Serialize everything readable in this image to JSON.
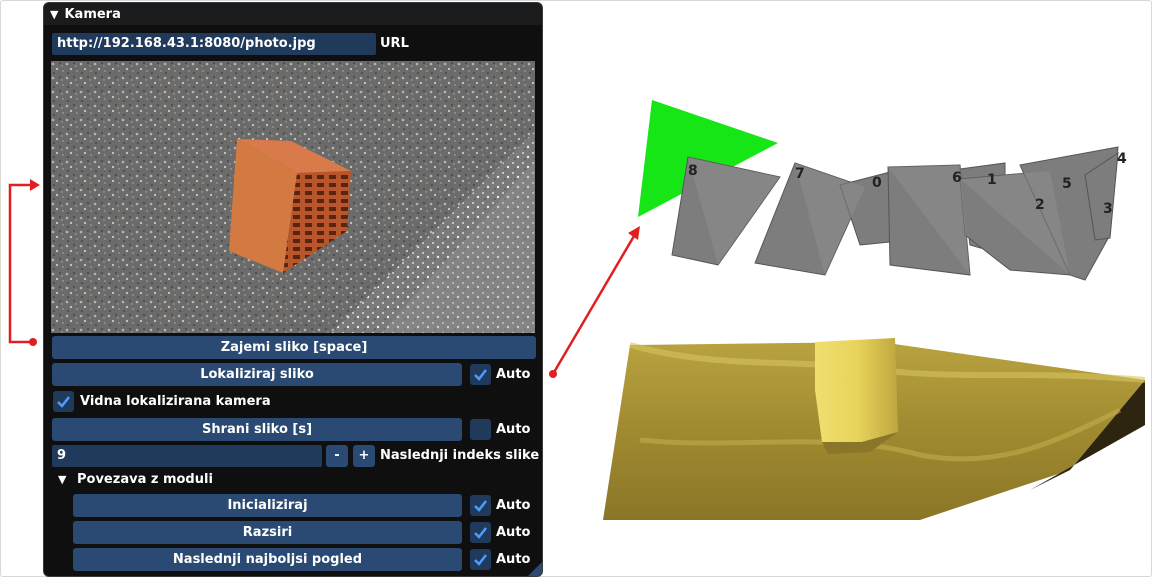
{
  "window": {
    "title": "Kamera"
  },
  "camera": {
    "url_value": "http://192.168.43.1:8080/photo.jpg",
    "url_label": "URL"
  },
  "controls": {
    "capture_button": "Zajemi sliko [space]",
    "localize_button": "Lokaliziraj sliko",
    "localize_auto_label": "Auto",
    "localize_auto_checked": true,
    "visible_localized_label": "Vidna lokalizirana kamera",
    "visible_localized_checked": true,
    "save_button": "Shrani sliko [s]",
    "save_auto_label": "Auto",
    "save_auto_checked": false,
    "index_value": "9",
    "minus_label": "-",
    "plus_label": "+",
    "index_label": "Naslednji indeks slike"
  },
  "modules": {
    "header": "Povezava z moduli",
    "items": [
      {
        "label": "Inicializiraj",
        "auto_label": "Auto",
        "auto_checked": true
      },
      {
        "label": "Razsiri",
        "auto_label": "Auto",
        "auto_checked": true
      },
      {
        "label": "Naslednji najboljsi pogled",
        "auto_label": "Auto",
        "auto_checked": true
      }
    ]
  },
  "scene": {
    "camera_labels": [
      "8",
      "7",
      "0",
      "6",
      "1",
      "5",
      "2",
      "4",
      "3"
    ],
    "highlight_color": "#16e516",
    "camera_color": "#7d7d7d",
    "mesh_color": "#c9b250",
    "arrow_color": "#e02020"
  }
}
